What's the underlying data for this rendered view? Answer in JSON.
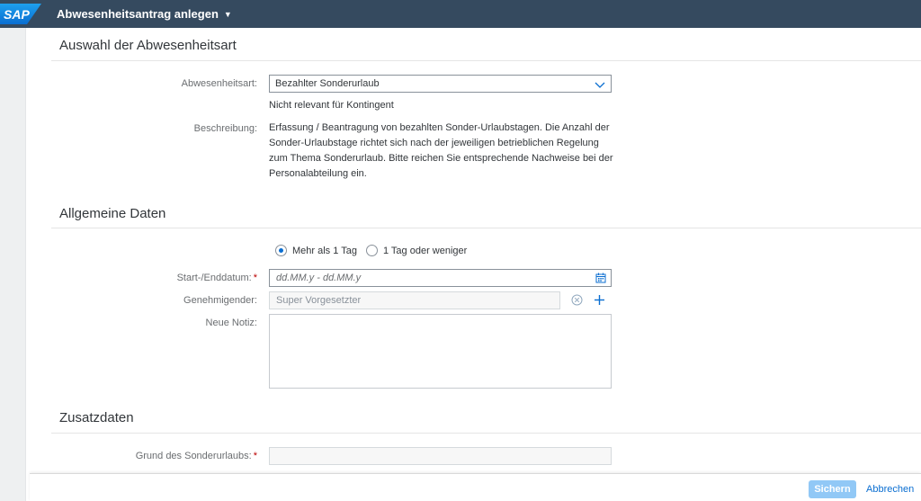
{
  "shell": {
    "logo_text": "SAP",
    "title": "Abwesenheitsantrag anlegen",
    "caret_icon": "triangle-down-icon"
  },
  "section1": {
    "title": "Auswahl der Abwesenheitsart",
    "absence_type_label": "Abwesenheitsart:",
    "absence_type_value": "Bezahlter Sonderurlaub",
    "quota_note": "Nicht relevant für Kontingent",
    "description_label": "Beschreibung:",
    "description_lines": [
      "Erfassung / Beantragung von bezahlten Sonder-Urlaubstagen. Die Anzahl der",
      "Sonder-Urlaubstage richtet sich nach der jeweiligen betrieblichen Regelung",
      "zum Thema Sonderurlaub. Bitte reichen Sie entsprechende Nachweise bei der",
      "Personalabteilung ein."
    ]
  },
  "section2": {
    "title": "Allgemeine Daten",
    "radio_more": "Mehr als 1 Tag",
    "radio_less": "1 Tag oder weniger",
    "radio_selected": "more",
    "date_label": "Start-/Enddatum:",
    "date_placeholder": "dd.MM.y - dd.MM.y",
    "approver_label": "Genehmigender:",
    "approver_value": "Super Vorgesetzter",
    "note_label": "Neue Notiz:"
  },
  "section3": {
    "title": "Zusatzdaten",
    "reason_label": "Grund des Sonderurlaubs:"
  },
  "required_mark": "*",
  "footer": {
    "save_label": "Sichern",
    "cancel_label": "Abbrechen"
  },
  "colors": {
    "shell_bg": "#354a5f",
    "accent": "#0a6ed1",
    "save_disabled": "#91c8f6",
    "required": "#bb0000"
  }
}
